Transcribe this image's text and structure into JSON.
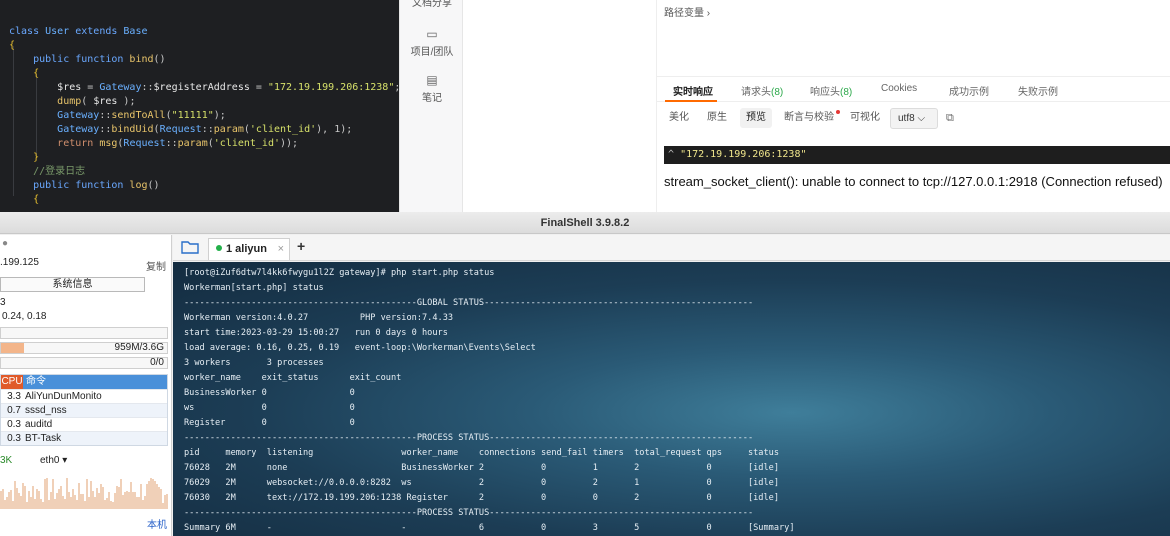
{
  "editor": {
    "lines": [
      "class User extends Base",
      "{",
      "public function bind()",
      "{",
      "$res = Gateway::$registerAddress = \"172.19.199.206:1238\";",
      "dump( $res );",
      "Gateway::sendToAll(\"11111\");",
      "Gateway::bindUid(Request::param('client_id'), 1);",
      "return msg(Request::param('client_id'));",
      "}",
      "//登录日志",
      "public function log()",
      "{"
    ]
  },
  "midbar": {
    "top_partial": "文档分享",
    "items": [
      {
        "icon": "▭",
        "label": "项目/团队"
      },
      {
        "icon": "▤",
        "label": "笔记"
      }
    ]
  },
  "api": {
    "path_var": "路径变量 ›",
    "tabs": [
      {
        "label": "实时响应",
        "count": ""
      },
      {
        "label": "请求头",
        "count": "(8)"
      },
      {
        "label": "响应头",
        "count": "(8)"
      },
      {
        "label": "Cookies",
        "count": ""
      },
      {
        "label": "成功示例",
        "count": ""
      },
      {
        "label": "失败示例",
        "count": ""
      }
    ],
    "subtabs": [
      "美化",
      "原生",
      "预览",
      "断言与校验",
      "可视化"
    ],
    "encoding": "utf8 ⌵",
    "json_caret": "^",
    "json_value": "\"172.19.199.206:1238\"",
    "error": "stream_socket_client(): unable to connect to tcp://127.0.0.1:2918 (Connection refused)"
  },
  "finalshell": {
    "title": "FinalShell 3.9.8.2",
    "left": {
      "ip": ".199.125",
      "copy": "复制",
      "sysinfo": "系统信息",
      "row3": "3",
      "load": "0.24, 0.18",
      "mem": "959M/3.6G",
      "swap": "0/0",
      "mem_fill": 0.14,
      "proc_header_cpu": "CPU",
      "proc_header_cmd": "命令",
      "processes": [
        {
          "cpu": "3.3",
          "name": "AliYunDunMonito"
        },
        {
          "cpu": "0.7",
          "name": "sssd_nss"
        },
        {
          "cpu": "0.3",
          "name": "auditd"
        },
        {
          "cpu": "0.3",
          "name": "BT-Task"
        }
      ],
      "net_speed": "3K",
      "net_iface": "eth0 ▾",
      "local": "本机"
    },
    "tab": {
      "label": "1 aliyun",
      "close": "×",
      "add": "+"
    },
    "terminal": [
      "[root@iZuf6dtw7l4kk6fwygu1l2Z gateway]# php start.php status",
      "Workerman[start.php] status",
      "---------------------------------------------GLOBAL STATUS----------------------------------------------------",
      "Workerman version:4.0.27          PHP version:7.4.33",
      "start time:2023-03-29 15:00:27   run 0 days 0 hours",
      "load average: 0.16, 0.25, 0.19   event-loop:\\Workerman\\Events\\Select",
      "3 workers       3 processes",
      "worker_name    exit_status      exit_count",
      "BusinessWorker 0                0",
      "ws             0                0",
      "Register       0                0",
      "---------------------------------------------PROCESS STATUS---------------------------------------------------",
      "pid     memory  listening                 worker_name    connections send_fail timers  total_request qps     status",
      "76028   2M      none                      BusinessWorker 2           0         1       2             0       [idle]",
      "76029   2M      websocket://0.0.0.0:8282  ws             2           0         2       1             0       [idle]",
      "76030   2M      text://172.19.199.206:1238 Register      2           0         0       2             0       [idle]",
      "---------------------------------------------PROCESS STATUS---------------------------------------------------",
      "Summary 6M      -                         -              6           0         3       5             0       [Summary]"
    ]
  }
}
